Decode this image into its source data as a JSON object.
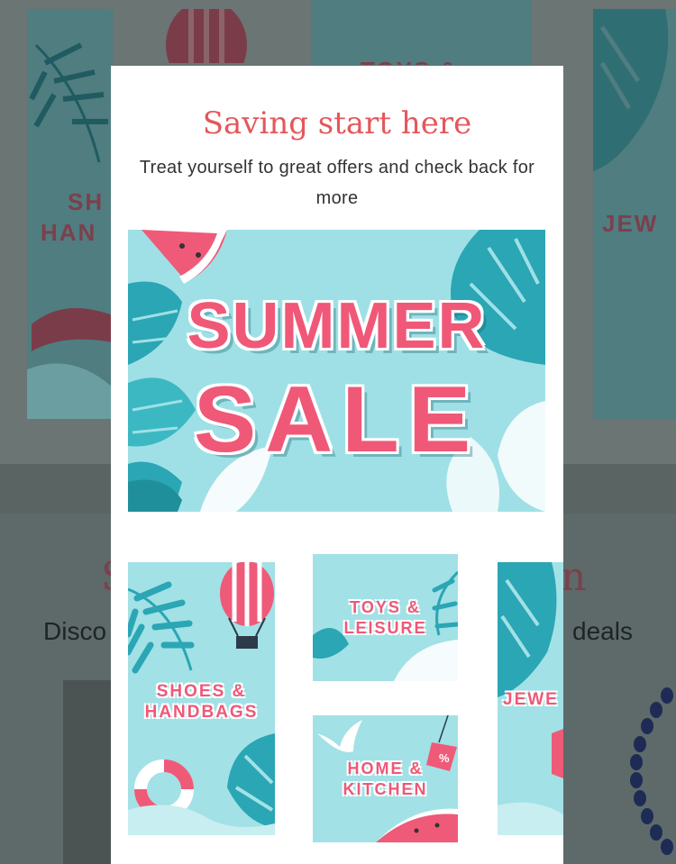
{
  "background": {
    "cards": [
      {
        "label_line1": "SH",
        "label_line2": "HAN"
      },
      {
        "label_line1": "TOYS &",
        "label_line2": ""
      },
      {
        "label_line1": "JEW",
        "label_line2": ""
      }
    ],
    "heading_left": "Disco",
    "heading_right": "deals",
    "section_partial_left": "S",
    "section_partial_right": "n"
  },
  "modal": {
    "title": "Saving start here",
    "subtitle": "Treat yourself to great offers and check back for more",
    "hero": {
      "line1": "SUMMER",
      "line2": "SALE"
    },
    "tiles": [
      {
        "line1": "SHOES &",
        "line2": "HANDBAGS"
      },
      {
        "line1": "TOYS &",
        "line2": "LEISURE"
      },
      {
        "line1": "HOME &",
        "line2": "KITCHEN"
      },
      {
        "line1": "JEWE",
        "line2": ""
      }
    ]
  },
  "colors": {
    "accent": "#e4575b",
    "sale_pink": "#f05878",
    "teal": "#a2e1e6",
    "leaf": "#2aa6b4"
  }
}
